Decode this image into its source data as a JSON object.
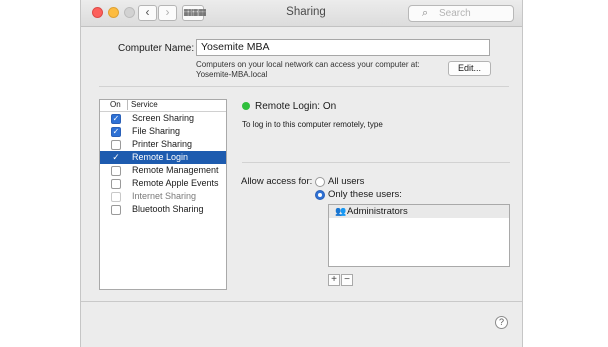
{
  "window": {
    "title": "Sharing",
    "search_placeholder": "Search"
  },
  "nav": {
    "back": "‹",
    "forward": "›",
    "grid": "▦▦▦"
  },
  "computer": {
    "label": "Computer Name:",
    "name": "Yosemite MBA",
    "note_line1": "Computers on your local network can access your computer at:",
    "note_line2": "Yosemite-MBA.local",
    "edit_label": "Edit..."
  },
  "services": {
    "header_on": "On",
    "header_service": "Service",
    "items": [
      {
        "label": "Screen Sharing",
        "checked": true
      },
      {
        "label": "File Sharing",
        "checked": true
      },
      {
        "label": "Printer Sharing",
        "checked": false
      },
      {
        "label": "Remote Login",
        "checked": true,
        "selected": true
      },
      {
        "label": "Remote Management",
        "checked": false
      },
      {
        "label": "Remote Apple Events",
        "checked": false
      },
      {
        "label": "Internet Sharing",
        "checked": false,
        "disabled": true
      },
      {
        "label": "Bluetooth Sharing",
        "checked": false
      }
    ]
  },
  "detail": {
    "status": "Remote Login: On",
    "status_color": "#2fbf3c",
    "note": "To log in to this computer remotely, type",
    "access_label": "Allow access for:",
    "option_all": "All users",
    "option_only": "Only these users:",
    "selected_option": "Only these users:",
    "users": [
      "Administrators"
    ],
    "plus": "+",
    "minus": "−"
  },
  "help_label": "?",
  "colors": {
    "selection": "#1d5baf",
    "accent": "#2e71d5"
  }
}
